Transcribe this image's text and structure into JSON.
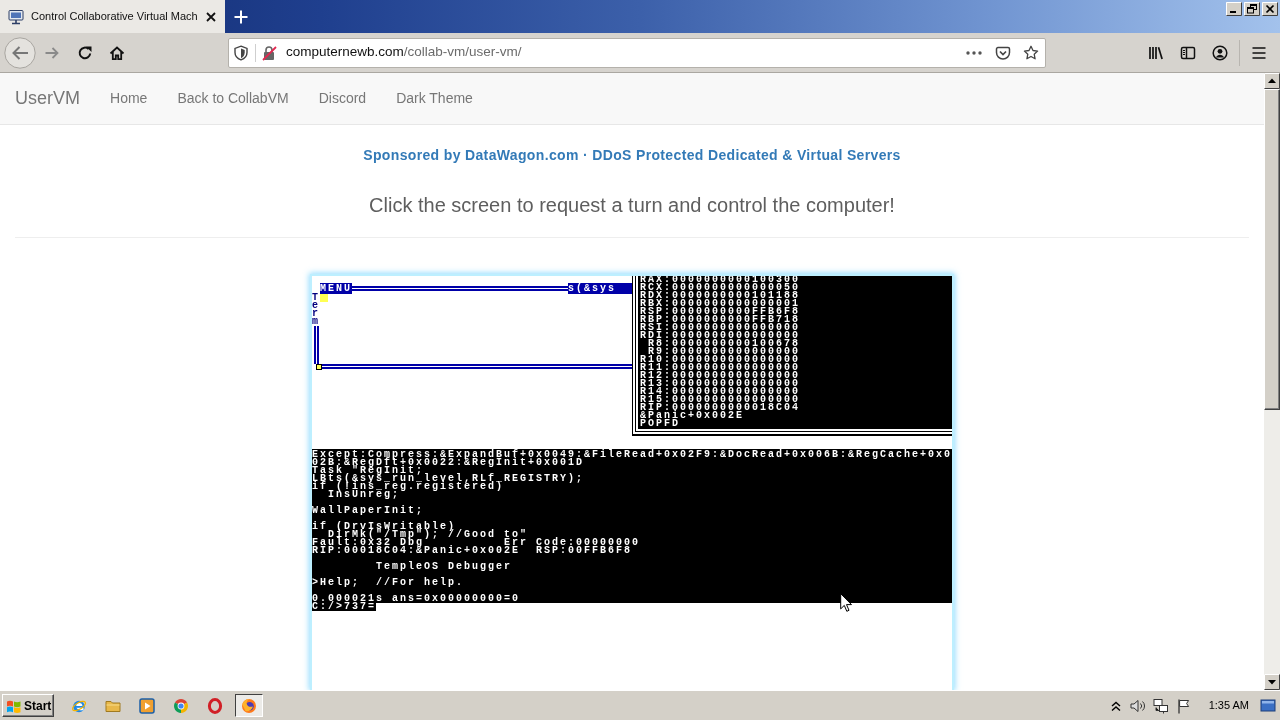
{
  "tabs": [
    {
      "title": "Control Collaborative Virtual Mach",
      "selected": true
    }
  ],
  "address_bar": {
    "host": "computernewb.com",
    "path": "/collab-vm/user-vm/"
  },
  "navbar": {
    "brand": "UserVM",
    "links": [
      "Home",
      "Back to CollabVM",
      "Discord",
      "Dark Theme"
    ]
  },
  "sponsor": "Sponsored by DataWagon.com · DDoS Protected Dedicated & Virtual Servers",
  "prompt": "Click the screen to request a turn and control the computer!",
  "vm_screen": {
    "menu_label": "MENU",
    "title_fragment": "s(&sys",
    "side_label": "Term",
    "registers": [
      "RAX:0000000000100300",
      "RCX:0000000000000050",
      "RDX:0000000000101188",
      "RBX:0000000000000001",
      "RSP:0000000000FFB6F8",
      "RBP:0000000000FFB718",
      "RSI:0000000000000000",
      "RDI:0000000000000000",
      " R8:0000000000100678",
      " R9:0000000000000000",
      "R10:0000000000000000",
      "R11:0000000000000000",
      "R12:0000000000000000",
      "R13:0000000000000000",
      "R14:0000000000000000",
      "R15:0000000000000000",
      "RIP:0000000000018C04",
      "&Panic+0x002E",
      "POPFD"
    ],
    "terminal_blocks": [
      [
        "Except:Compress:&ExpandBuf+0x0049:&FileRead+0x02F9:&DocRead+0x006B:&RegCache+0x0",
        "02B:&RegDft+0x0022:&RegInit+0x001D",
        "Task \"RegInit;",
        "LBts(&sys_run_level,RLf_REGISTRY);",
        "if (!ins_reg.registered)",
        "  InsUnreg;"
      ],
      [
        "WallPaperInit;"
      ],
      [
        "if (DrvIsWritable)",
        "  DirMk(\"/Tmp\"); //Good to\"",
        "Fault:0x32 Dbg          Err Code:00000000",
        "RIP:00018C04:&Panic+0x002E  RSP:00FFB6F8"
      ],
      [
        "        TempleOS Debugger"
      ],
      [
        ">Help;  //For help."
      ],
      [
        "0.000021s ans=0x00000000=0"
      ]
    ],
    "command_line": "C:/>737="
  },
  "taskbar": {
    "start": "Start",
    "tasks": [
      {
        "selected": true
      }
    ],
    "clock": "1:35 AM"
  }
}
